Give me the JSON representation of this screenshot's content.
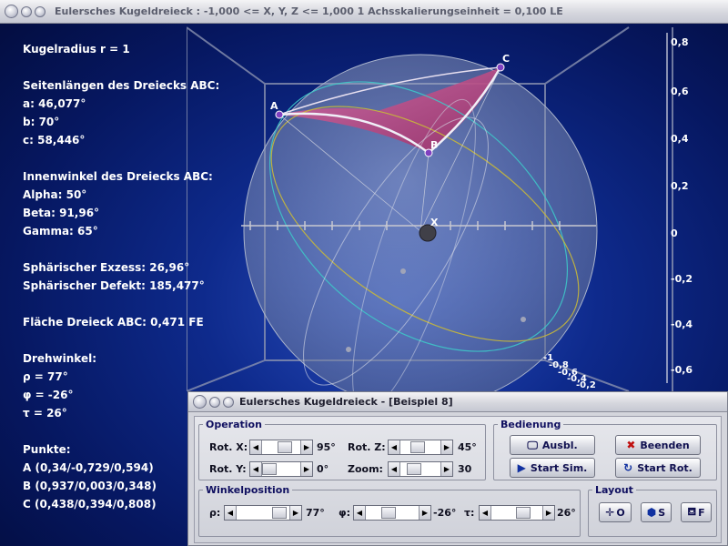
{
  "main_window": {
    "title": "Eulersches Kugeldreieck :      -1,000 <= X, Y, Z <= 1,000    1 Achsskalierungseinheit = 0,100 LE"
  },
  "info": {
    "radius": "Kugelradius  r = 1",
    "sides_heading": "Seitenlängen des Dreiecks ABC:",
    "side_a": "a: 46,077°",
    "side_b": "b: 70°",
    "side_c": "c: 58,446°",
    "angles_heading": "Innenwinkel des Dreiecks ABC:",
    "alpha": "Alpha: 50°",
    "beta": "Beta: 91,96°",
    "gamma": "Gamma: 65°",
    "excess": "Sphärischer Exzess: 26,96°",
    "defect": "Sphärischer Defekt: 185,477°",
    "area": "Fläche Dreieck ABC: 0,471 FE",
    "rot_heading": "Drehwinkel:",
    "rho": "ρ = 77°",
    "phi": "φ = -26°",
    "tau": "τ = 26°",
    "points_heading": "Punkte:",
    "point_a": "A (0,34/-0,729/0,594)",
    "point_b": "B (0,937/0,003/0,348)",
    "point_c": "C (0,438/0,394/0,808)"
  },
  "scene": {
    "labels": {
      "A": "A",
      "B": "B",
      "C": "C",
      "X": "X"
    },
    "y_ticks": [
      "0,8",
      "0,6",
      "0,4",
      "0,2",
      "0",
      "-0,2",
      "-0,4",
      "-0,6"
    ],
    "z_ticks": [
      "-1",
      "-0,8",
      "-0,6",
      "-0,4",
      "-0,2"
    ],
    "colors": {
      "triangle": "#c0407a",
      "sphere": "#8a9ab8",
      "equator_cyan": "#3ec6c8",
      "equator_yellow": "#c8b838",
      "axis": "#c0c0c0"
    }
  },
  "dialog": {
    "title": "Eulersches Kugeldreieck - [Beispiel 8]",
    "operation": {
      "legend": "Operation",
      "rot_x_label": "Rot. X:",
      "rot_x_value": "95°",
      "rot_y_label": "Rot. Y:",
      "rot_y_value": "0°",
      "rot_z_label": "Rot. Z:",
      "rot_z_value": "45°",
      "zoom_label": "Zoom:",
      "zoom_value": "30"
    },
    "bedienung": {
      "legend": "Bedienung",
      "ausbl": "Ausbl.",
      "beenden": "Beenden",
      "start_sim": "Start Sim.",
      "start_rot": "Start Rot."
    },
    "winkelposition": {
      "legend": "Winkelposition",
      "rho_label": "ρ:",
      "rho_value": "77°",
      "phi_label": "φ:",
      "phi_value": "-26°",
      "tau_label": "τ:",
      "tau_value": "26°"
    },
    "layout": {
      "legend": "Layout",
      "btn_o": "O",
      "btn_s": "S",
      "btn_f": "F"
    }
  }
}
